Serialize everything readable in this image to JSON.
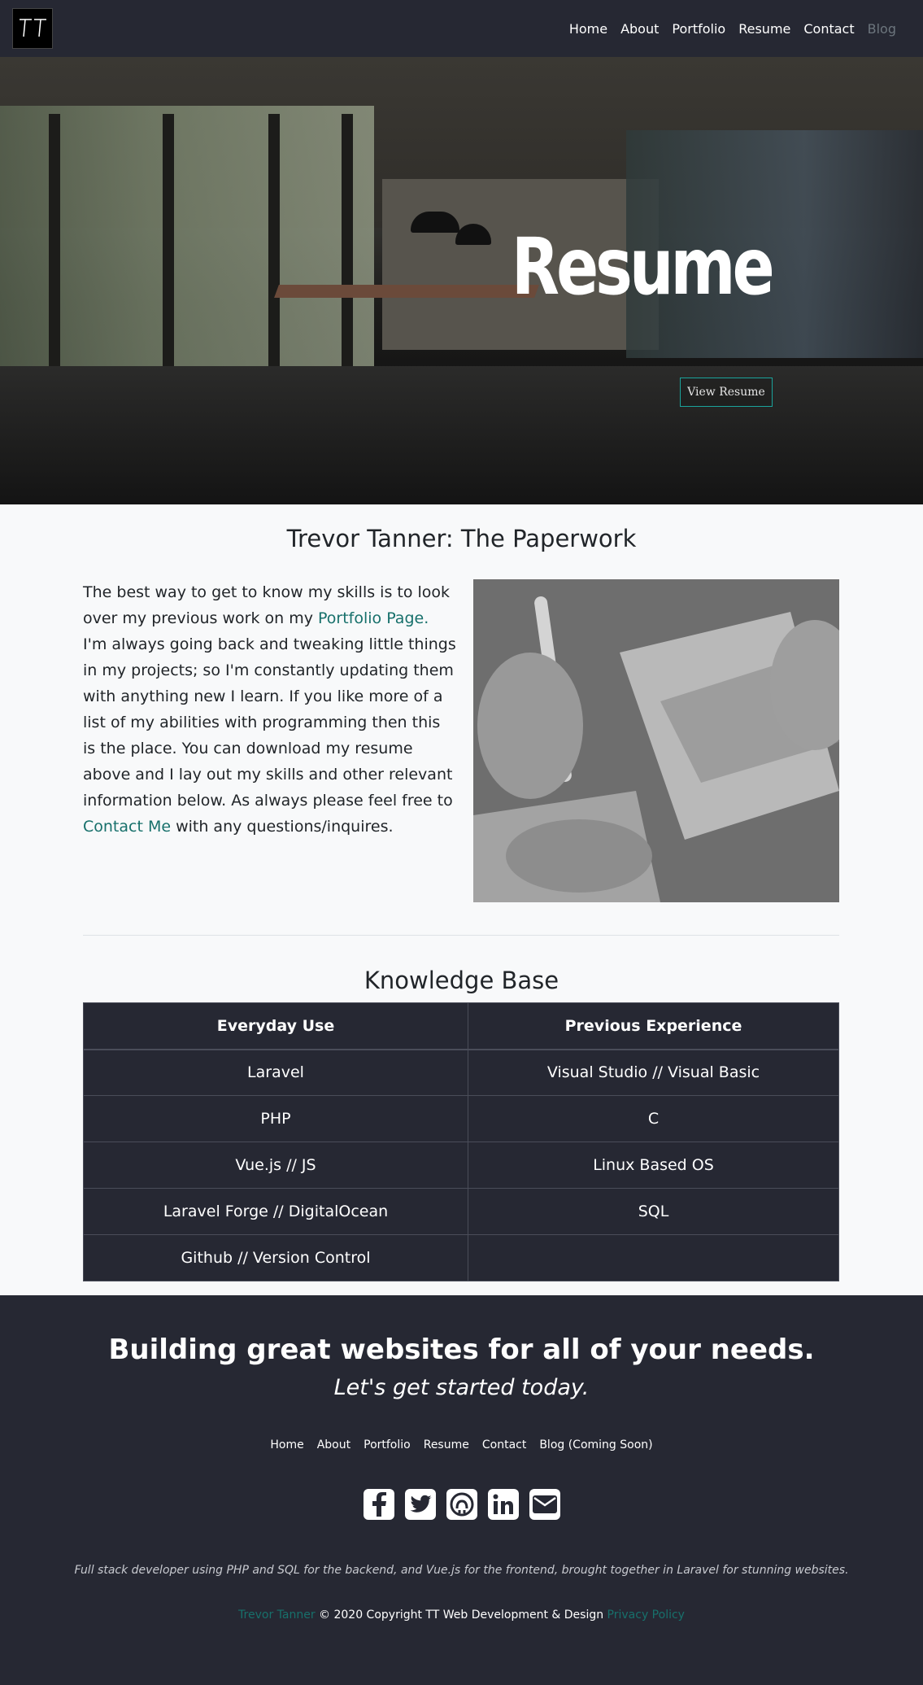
{
  "nav": {
    "logo_label": "TT",
    "items": [
      {
        "label": "Home"
      },
      {
        "label": "About"
      },
      {
        "label": "Portfolio"
      },
      {
        "label": "Resume"
      },
      {
        "label": "Contact"
      },
      {
        "label": "Blog",
        "muted": true
      }
    ]
  },
  "hero": {
    "title": "Resume",
    "button": "View Resume"
  },
  "paperwork": {
    "title": "Trevor Tanner: The Paperwork",
    "text_1": "The best way to get to know my skills is to look over my previous work on my ",
    "portfolio_link": "Portfolio Page.",
    "text_2": " I'm always going back and tweaking little things in my projects; so I'm constantly updating them with anything new I learn. If you like more of a list of my abilities with programming then this is the place. You can download my resume above and I lay out my skills and other relevant information below. As always please feel free to ",
    "contact_link": "Contact Me",
    "text_3": " with any questions/inquires."
  },
  "knowledge": {
    "title": "Knowledge Base",
    "headers": [
      "Everyday Use",
      "Previous Experience"
    ],
    "rows": [
      [
        "Laravel",
        "Visual Studio // Visual Basic"
      ],
      [
        "PHP",
        "C"
      ],
      [
        "Vue.js // JS",
        "Linux Based OS"
      ],
      [
        "Laravel Forge // DigitalOcean",
        "SQL"
      ],
      [
        "Github // Version Control",
        ""
      ]
    ]
  },
  "footer": {
    "heading": "Building great websites for all of your needs.",
    "subheading": "Let's get started today.",
    "links": [
      "Home",
      "About",
      "Portfolio",
      "Resume",
      "Contact",
      "Blog (Coming Soon)"
    ],
    "socials": [
      "facebook-icon",
      "twitter-icon",
      "github-icon",
      "linkedin-icon",
      "envelope-icon"
    ],
    "description": "Full stack developer using PHP and SQL for the backend, and Vue.js for the frontend, brought together in Laravel for stunning websites.",
    "copy_name": "Trevor Tanner",
    "copy_text": " © 2020 Copyright TT Web Development & Design ",
    "copy_policy": "Privacy Policy"
  },
  "colors": {
    "dark": "#262833",
    "accent": "#17706b",
    "light": "#f8f9fa"
  }
}
